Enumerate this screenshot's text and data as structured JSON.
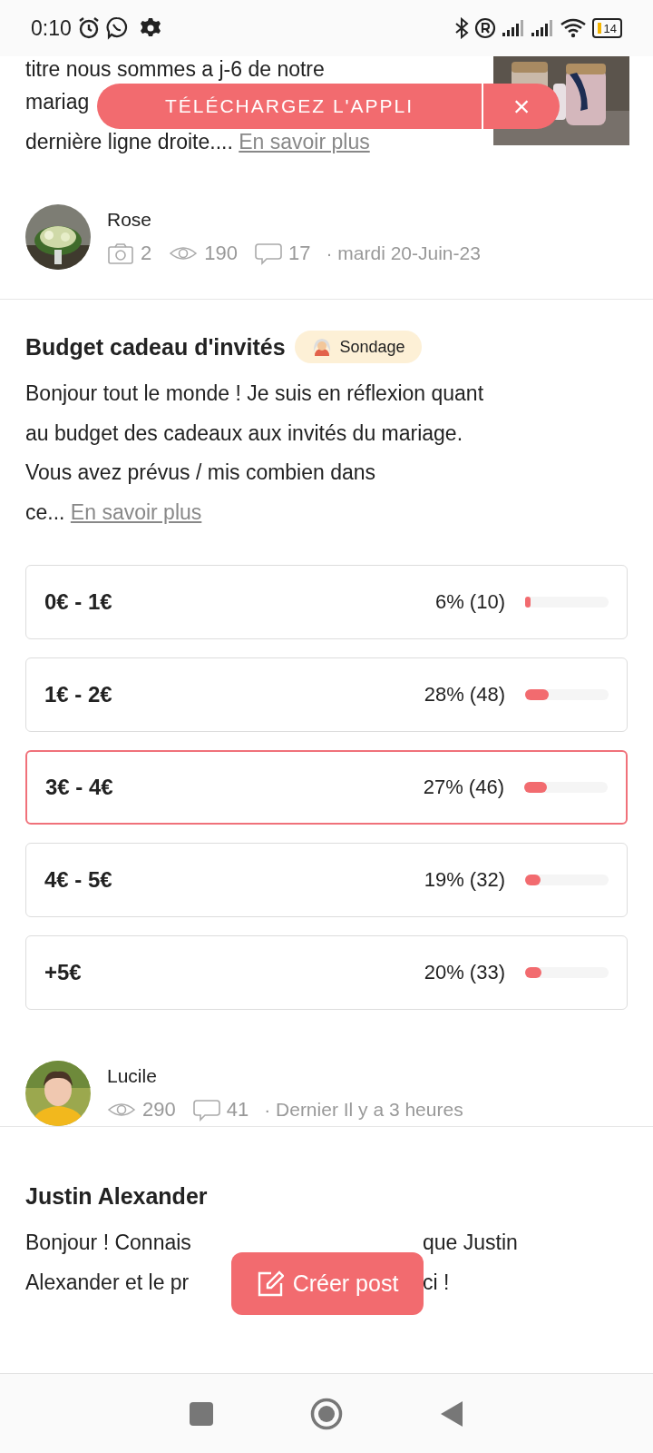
{
  "status_bar": {
    "time": "0:10",
    "battery": "14"
  },
  "banner": {
    "label": "TÉLÉCHARGEZ L'APPLI",
    "close": "×"
  },
  "posts": [
    {
      "kind": "excerpt",
      "lines": [
        "titre nous sommes a j-6 de notre",
        "mariag",
        "dernière ligne droite...."
      ],
      "more_link": "En savoir plus",
      "author": "Rose",
      "photos": "2",
      "views": "190",
      "comments": "17",
      "date": "· mardi 20-Juin-23"
    },
    {
      "kind": "poll",
      "title": "Budget cadeau d'invités",
      "tag": "Sondage",
      "lines": [
        "Bonjour tout le monde ! Je suis en réflexion quant",
        "au budget des cadeaux aux invités du mariage.",
        "Vous avez prévus / mis combien dans",
        "ce..."
      ],
      "more_link": "En savoir plus",
      "options": [
        {
          "label": "0€ - 1€",
          "result": "6% (10)",
          "level": 0.06,
          "selected": false
        },
        {
          "label": "1€ - 2€",
          "result": "28% (48)",
          "level": 0.28,
          "selected": false
        },
        {
          "label": "3€ - 4€",
          "result": "27% (46)",
          "level": 0.27,
          "selected": true
        },
        {
          "label": "4€ - 5€",
          "result": "19% (32)",
          "level": 0.19,
          "selected": false
        },
        {
          "label": "+5€",
          "result": "20% (33)",
          "level": 0.2,
          "selected": false
        }
      ],
      "author": "Lucile",
      "views": "290",
      "comments": "41",
      "date": "· Dernier Il y a 3 heures"
    },
    {
      "kind": "split",
      "title": "Justin Alexander",
      "line_parts": [
        [
          "Bonjour ! Connais",
          "que Justin"
        ],
        [
          "Alexander et le pr",
          "ci !"
        ]
      ]
    }
  ],
  "create_button": "Créer post"
}
